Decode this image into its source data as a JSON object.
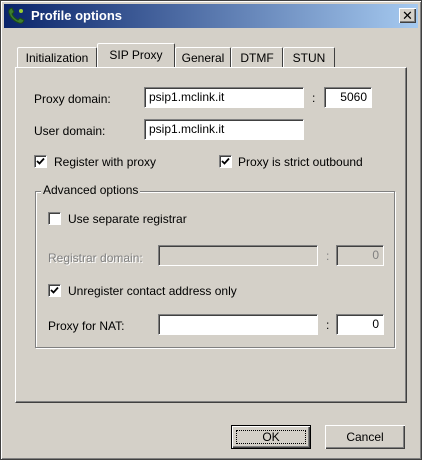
{
  "window": {
    "title": "Profile options",
    "close_symbol": "✕"
  },
  "tabs": [
    {
      "label": "Initialization"
    },
    {
      "label": "SIP Proxy",
      "active": true
    },
    {
      "label": "General"
    },
    {
      "label": "DTMF"
    },
    {
      "label": "STUN"
    }
  ],
  "sip_proxy": {
    "proxy_domain_label": "Proxy domain:",
    "proxy_domain_value": "psip1.mclink.it",
    "proxy_port_value": "5060",
    "port_separator": ":",
    "user_domain_label": "User domain:",
    "user_domain_value": "psip1.mclink.it",
    "register_with_proxy_label": "Register with proxy",
    "register_with_proxy_checked": true,
    "strict_outbound_label": "Proxy is strict outbound",
    "strict_outbound_checked": true
  },
  "advanced": {
    "group_title": "Advanced options",
    "separate_registrar_label": "Use separate registrar",
    "separate_registrar_checked": false,
    "registrar_domain_label": "Registrar domain:",
    "registrar_domain_value": "",
    "registrar_port_value": "0",
    "unregister_label": "Unregister contact address only",
    "unregister_checked": true,
    "proxy_nat_label": "Proxy for NAT:",
    "proxy_nat_value": "",
    "proxy_nat_port_value": "0"
  },
  "buttons": {
    "ok_label": "OK",
    "cancel_label": "Cancel"
  },
  "colors": {
    "titlebar_start": "#0a246a",
    "titlebar_end": "#a6caf0",
    "face": "#d4d0c8"
  },
  "icons": {
    "app": "phone-app-icon",
    "check": "checkmark-icon"
  }
}
